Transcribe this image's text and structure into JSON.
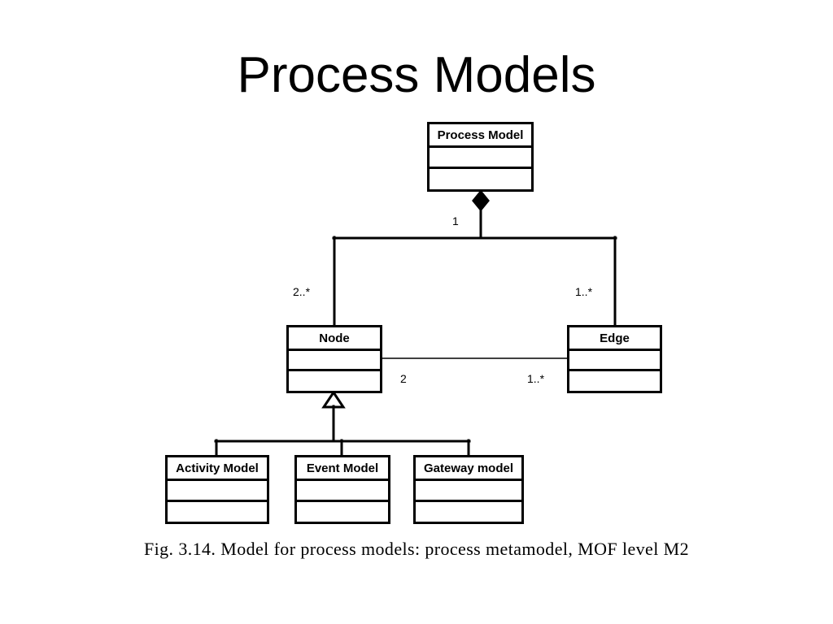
{
  "slide": {
    "title": "Process Models",
    "background_color": "#ffffff",
    "line_color": "#000000"
  },
  "diagram": {
    "kind": "uml-class-diagram",
    "classes": [
      {
        "id": "process-model",
        "name": "Process Model",
        "attributes": [],
        "operations": []
      },
      {
        "id": "node",
        "name": "Node",
        "attributes": [],
        "operations": []
      },
      {
        "id": "edge",
        "name": "Edge",
        "attributes": [],
        "operations": []
      },
      {
        "id": "activity-model",
        "name": "Activity Model",
        "attributes": [],
        "operations": []
      },
      {
        "id": "event-model",
        "name": "Event Model",
        "attributes": [],
        "operations": []
      },
      {
        "id": "gateway-model",
        "name": "Gateway model",
        "attributes": [],
        "operations": []
      }
    ],
    "relations": [
      {
        "id": "composition-processmodel-node",
        "type": "composition",
        "from": "process-model",
        "to": "node",
        "source_multiplicity": "1",
        "target_multiplicity": "2..*",
        "diamond": "filled"
      },
      {
        "id": "composition-processmodel-edge",
        "type": "composition",
        "from": "process-model",
        "to": "edge",
        "source_multiplicity": "1",
        "target_multiplicity": "1..*",
        "diamond": "filled"
      },
      {
        "id": "association-node-edge",
        "type": "association",
        "from": "node",
        "to": "edge",
        "source_multiplicity": "2",
        "target_multiplicity": "1..*"
      },
      {
        "id": "generalization-node-subclasses",
        "type": "generalization",
        "parent": "node",
        "children": [
          "activity-model",
          "event-model",
          "gateway-model"
        ],
        "arrow": "hollow-triangle"
      }
    ],
    "multiplicity_labels": {
      "composition_top": "1",
      "node_end": "2..*",
      "edge_end": "1..*",
      "assoc_node_end": "2",
      "assoc_edge_end": "1..*"
    }
  },
  "caption": {
    "text": "Fig. 3.14. Model for process models: process metamodel, MOF level M2"
  }
}
